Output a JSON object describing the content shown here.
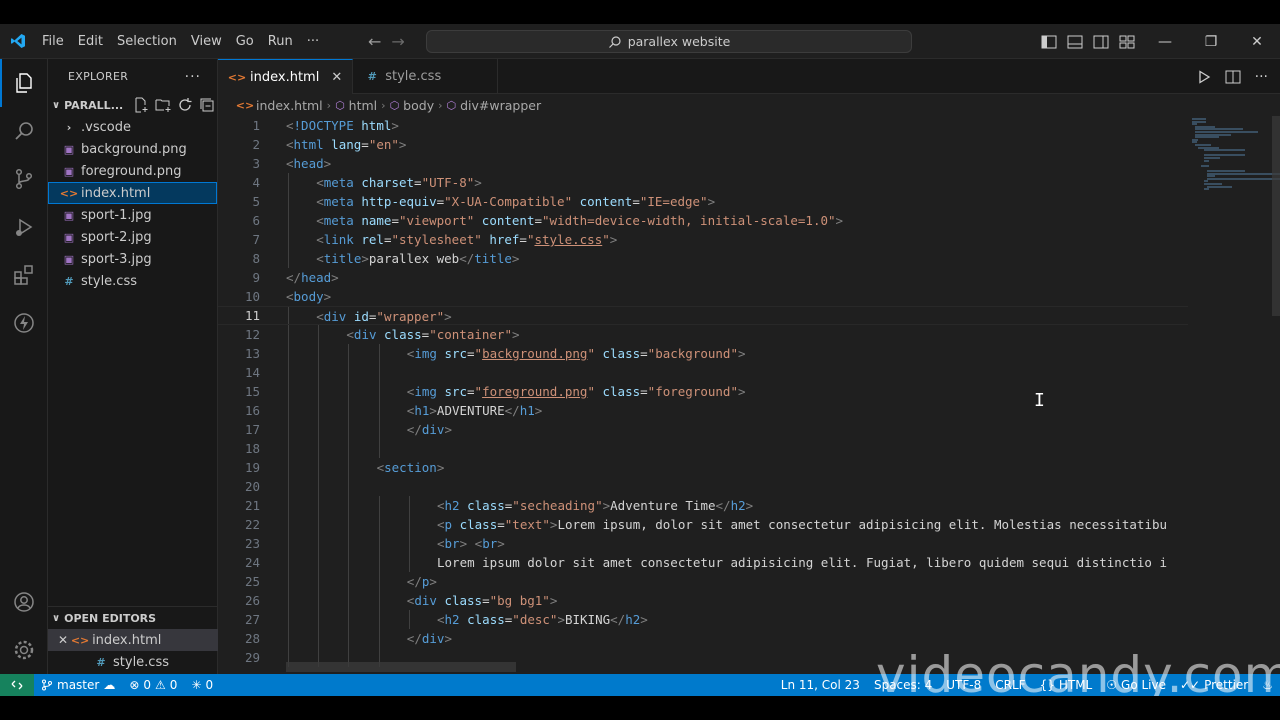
{
  "menu": [
    "File",
    "Edit",
    "Selection",
    "View",
    "Go",
    "Run",
    "···"
  ],
  "search": {
    "text": "parallex website"
  },
  "explorer": {
    "title": "EXPLORER",
    "folder": "PARALL...",
    "files": [
      {
        "name": ".vscode",
        "type": "folder"
      },
      {
        "name": "background.png",
        "type": "image"
      },
      {
        "name": "foreground.png",
        "type": "image"
      },
      {
        "name": "index.html",
        "type": "html",
        "selected": true
      },
      {
        "name": "sport-1.jpg",
        "type": "image"
      },
      {
        "name": "sport-2.jpg",
        "type": "image"
      },
      {
        "name": "sport-3.jpg",
        "type": "image"
      },
      {
        "name": "style.css",
        "type": "css"
      }
    ]
  },
  "open_editors": {
    "title": "OPEN EDITORS",
    "items": [
      {
        "name": "index.html",
        "type": "html",
        "active": true
      },
      {
        "name": "style.css",
        "type": "css",
        "active": false
      }
    ]
  },
  "tabs": [
    {
      "label": "index.html",
      "type": "html",
      "active": true
    },
    {
      "label": "style.css",
      "type": "css",
      "active": false
    }
  ],
  "breadcrumb": [
    "index.html",
    "html",
    "body",
    "div#wrapper"
  ],
  "current_line": 11,
  "code_lines": [
    {
      "n": "1",
      "indent": 0,
      "tokens": [
        [
          "p",
          "<"
        ],
        [
          "d",
          "!DOCTYPE"
        ],
        [
          "t",
          " "
        ],
        [
          "a",
          "html"
        ],
        [
          "p",
          ">"
        ]
      ]
    },
    {
      "n": "2",
      "indent": 0,
      "tokens": [
        [
          "p",
          "<"
        ],
        [
          "g",
          "html"
        ],
        [
          "t",
          " "
        ],
        [
          "a",
          "lang"
        ],
        [
          "t",
          "="
        ],
        [
          "s",
          "\"en\""
        ],
        [
          "p",
          ">"
        ]
      ]
    },
    {
      "n": "3",
      "indent": 0,
      "tokens": [
        [
          "p",
          "<"
        ],
        [
          "g",
          "head"
        ],
        [
          "p",
          ">"
        ]
      ]
    },
    {
      "n": "4",
      "indent": 1,
      "tokens": [
        [
          "p",
          "<"
        ],
        [
          "g",
          "meta"
        ],
        [
          "t",
          " "
        ],
        [
          "a",
          "charset"
        ],
        [
          "t",
          "="
        ],
        [
          "s",
          "\"UTF-8\""
        ],
        [
          "p",
          ">"
        ]
      ]
    },
    {
      "n": "5",
      "indent": 1,
      "tokens": [
        [
          "p",
          "<"
        ],
        [
          "g",
          "meta"
        ],
        [
          "t",
          " "
        ],
        [
          "a",
          "http-equiv"
        ],
        [
          "t",
          "="
        ],
        [
          "s",
          "\"X-UA-Compatible\""
        ],
        [
          "t",
          " "
        ],
        [
          "a",
          "content"
        ],
        [
          "t",
          "="
        ],
        [
          "s",
          "\"IE=edge\""
        ],
        [
          "p",
          ">"
        ]
      ]
    },
    {
      "n": "6",
      "indent": 1,
      "tokens": [
        [
          "p",
          "<"
        ],
        [
          "g",
          "meta"
        ],
        [
          "t",
          " "
        ],
        [
          "a",
          "name"
        ],
        [
          "t",
          "="
        ],
        [
          "s",
          "\"viewport\""
        ],
        [
          "t",
          " "
        ],
        [
          "a",
          "content"
        ],
        [
          "t",
          "="
        ],
        [
          "s",
          "\"width=device-width, initial-scale=1.0\""
        ],
        [
          "p",
          ">"
        ]
      ]
    },
    {
      "n": "7",
      "indent": 1,
      "tokens": [
        [
          "p",
          "<"
        ],
        [
          "g",
          "link"
        ],
        [
          "t",
          " "
        ],
        [
          "a",
          "rel"
        ],
        [
          "t",
          "="
        ],
        [
          "s",
          "\"stylesheet\""
        ],
        [
          "t",
          " "
        ],
        [
          "a",
          "href"
        ],
        [
          "t",
          "="
        ],
        [
          "s",
          "\""
        ],
        [
          "u",
          "style.css"
        ],
        [
          "s",
          "\""
        ],
        [
          "p",
          ">"
        ]
      ]
    },
    {
      "n": "8",
      "indent": 1,
      "tokens": [
        [
          "p",
          "<"
        ],
        [
          "g",
          "title"
        ],
        [
          "p",
          ">"
        ],
        [
          "t",
          "parallex web"
        ],
        [
          "p",
          "</"
        ],
        [
          "g",
          "title"
        ],
        [
          "p",
          ">"
        ]
      ]
    },
    {
      "n": "9",
      "indent": 0,
      "tokens": [
        [
          "p",
          "</"
        ],
        [
          "g",
          "head"
        ],
        [
          "p",
          ">"
        ]
      ]
    },
    {
      "n": "10",
      "indent": 0,
      "tokens": [
        [
          "p",
          "<"
        ],
        [
          "g",
          "body"
        ],
        [
          "p",
          ">"
        ]
      ]
    },
    {
      "n": "11",
      "indent": 1,
      "tokens": [
        [
          "p",
          "<"
        ],
        [
          "g",
          "div"
        ],
        [
          "t",
          " "
        ],
        [
          "a",
          "id"
        ],
        [
          "t",
          "="
        ],
        [
          "s",
          "\"wrapper\""
        ],
        [
          "p",
          ">"
        ]
      ]
    },
    {
      "n": "12",
      "indent": 2,
      "tokens": [
        [
          "p",
          "<"
        ],
        [
          "g",
          "div"
        ],
        [
          "t",
          " "
        ],
        [
          "a",
          "class"
        ],
        [
          "t",
          "="
        ],
        [
          "s",
          "\"container\""
        ],
        [
          "p",
          ">"
        ]
      ]
    },
    {
      "n": "13",
      "indent": 4,
      "tokens": [
        [
          "p",
          "<"
        ],
        [
          "g",
          "img"
        ],
        [
          "t",
          " "
        ],
        [
          "a",
          "src"
        ],
        [
          "t",
          "="
        ],
        [
          "s",
          "\""
        ],
        [
          "u",
          "background.png"
        ],
        [
          "s",
          "\""
        ],
        [
          "t",
          " "
        ],
        [
          "a",
          "class"
        ],
        [
          "t",
          "="
        ],
        [
          "s",
          "\"background\""
        ],
        [
          "p",
          ">"
        ]
      ]
    },
    {
      "n": "14",
      "indent": 0,
      "tokens": []
    },
    {
      "n": "15",
      "indent": 4,
      "tokens": [
        [
          "p",
          "<"
        ],
        [
          "g",
          "img"
        ],
        [
          "t",
          " "
        ],
        [
          "a",
          "src"
        ],
        [
          "t",
          "="
        ],
        [
          "s",
          "\""
        ],
        [
          "u",
          "foreground.png"
        ],
        [
          "s",
          "\""
        ],
        [
          "t",
          " "
        ],
        [
          "a",
          "class"
        ],
        [
          "t",
          "="
        ],
        [
          "s",
          "\"foreground\""
        ],
        [
          "p",
          ">"
        ]
      ]
    },
    {
      "n": "16",
      "indent": 4,
      "tokens": [
        [
          "p",
          "<"
        ],
        [
          "g",
          "h1"
        ],
        [
          "p",
          ">"
        ],
        [
          "t",
          "ADVENTURE"
        ],
        [
          "p",
          "</"
        ],
        [
          "g",
          "h1"
        ],
        [
          "p",
          ">"
        ]
      ]
    },
    {
      "n": "17",
      "indent": 4,
      "tokens": [
        [
          "p",
          "</"
        ],
        [
          "g",
          "div"
        ],
        [
          "p",
          ">"
        ]
      ]
    },
    {
      "n": "18",
      "indent": 0,
      "tokens": []
    },
    {
      "n": "19",
      "indent": 3,
      "tokens": [
        [
          "p",
          "<"
        ],
        [
          "g",
          "section"
        ],
        [
          "p",
          ">"
        ]
      ]
    },
    {
      "n": "20",
      "indent": 0,
      "tokens": []
    },
    {
      "n": "21",
      "indent": 5,
      "tokens": [
        [
          "p",
          "<"
        ],
        [
          "g",
          "h2"
        ],
        [
          "t",
          " "
        ],
        [
          "a",
          "class"
        ],
        [
          "t",
          "="
        ],
        [
          "s",
          "\"secheading\""
        ],
        [
          "p",
          ">"
        ],
        [
          "t",
          "Adventure Time"
        ],
        [
          "p",
          "</"
        ],
        [
          "g",
          "h2"
        ],
        [
          "p",
          ">"
        ]
      ]
    },
    {
      "n": "22",
      "indent": 5,
      "tokens": [
        [
          "p",
          "<"
        ],
        [
          "g",
          "p"
        ],
        [
          "t",
          " "
        ],
        [
          "a",
          "class"
        ],
        [
          "t",
          "="
        ],
        [
          "s",
          "\"text\""
        ],
        [
          "p",
          ">"
        ],
        [
          "t",
          "Lorem ipsum, dolor sit amet consectetur adipisicing elit. Molestias necessitatibu"
        ]
      ]
    },
    {
      "n": "23",
      "indent": 5,
      "tokens": [
        [
          "p",
          "<"
        ],
        [
          "g",
          "br"
        ],
        [
          "p",
          ">"
        ],
        [
          "t",
          " "
        ],
        [
          "p",
          "<"
        ],
        [
          "g",
          "br"
        ],
        [
          "p",
          ">"
        ]
      ]
    },
    {
      "n": "24",
      "indent": 5,
      "tokens": [
        [
          "t",
          "Lorem ipsum dolor sit amet consectetur adipisicing elit. Fugiat, libero quidem sequi distinctio i"
        ]
      ]
    },
    {
      "n": "25",
      "indent": 4,
      "tokens": [
        [
          "p",
          "</"
        ],
        [
          "g",
          "p"
        ],
        [
          "p",
          ">"
        ]
      ]
    },
    {
      "n": "26",
      "indent": 4,
      "tokens": [
        [
          "p",
          "<"
        ],
        [
          "g",
          "div"
        ],
        [
          "t",
          " "
        ],
        [
          "a",
          "class"
        ],
        [
          "t",
          "="
        ],
        [
          "s",
          "\"bg bg1\""
        ],
        [
          "p",
          ">"
        ]
      ]
    },
    {
      "n": "27",
      "indent": 5,
      "tokens": [
        [
          "p",
          "<"
        ],
        [
          "g",
          "h2"
        ],
        [
          "t",
          " "
        ],
        [
          "a",
          "class"
        ],
        [
          "t",
          "="
        ],
        [
          "s",
          "\"desc\""
        ],
        [
          "p",
          ">"
        ],
        [
          "t",
          "BIKING"
        ],
        [
          "p",
          "</"
        ],
        [
          "g",
          "h2"
        ],
        [
          "p",
          ">"
        ]
      ]
    },
    {
      "n": "28",
      "indent": 4,
      "tokens": [
        [
          "p",
          "</"
        ],
        [
          "g",
          "div"
        ],
        [
          "p",
          ">"
        ]
      ]
    },
    {
      "n": "29",
      "indent": 0,
      "tokens": []
    }
  ],
  "status": {
    "branch": "master",
    "errors": "0",
    "warnings": "0",
    "ports": "0",
    "position": "Ln 11, Col 23",
    "spaces": "Spaces: 4",
    "encoding": "UTF-8",
    "eol": "CRLF",
    "language": "HTML",
    "live": "Go Live",
    "prettier": "Prettier"
  },
  "watermark": "videocandy.com",
  "colors": {
    "accent": "#0078d4",
    "statusbar": "#007acc",
    "remote": "#16825d",
    "selection": "#04395e"
  }
}
